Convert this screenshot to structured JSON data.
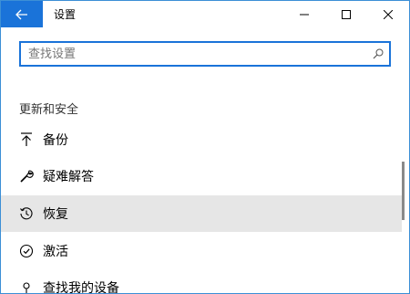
{
  "window": {
    "title": "设置"
  },
  "search": {
    "placeholder": "查找设置",
    "value": ""
  },
  "section": {
    "title": "更新和安全"
  },
  "menu": {
    "items": [
      {
        "label": "备份",
        "icon": "backup-arrow-icon"
      },
      {
        "label": "疑难解答",
        "icon": "wrench-icon"
      },
      {
        "label": "恢复",
        "icon": "history-icon",
        "selected": true
      },
      {
        "label": "激活",
        "icon": "check-circle-icon"
      },
      {
        "label": "查找我的设备",
        "icon": "find-device-icon"
      }
    ]
  },
  "colors": {
    "accent": "#1a73d9",
    "selected_bg": "#e6e6e6"
  }
}
